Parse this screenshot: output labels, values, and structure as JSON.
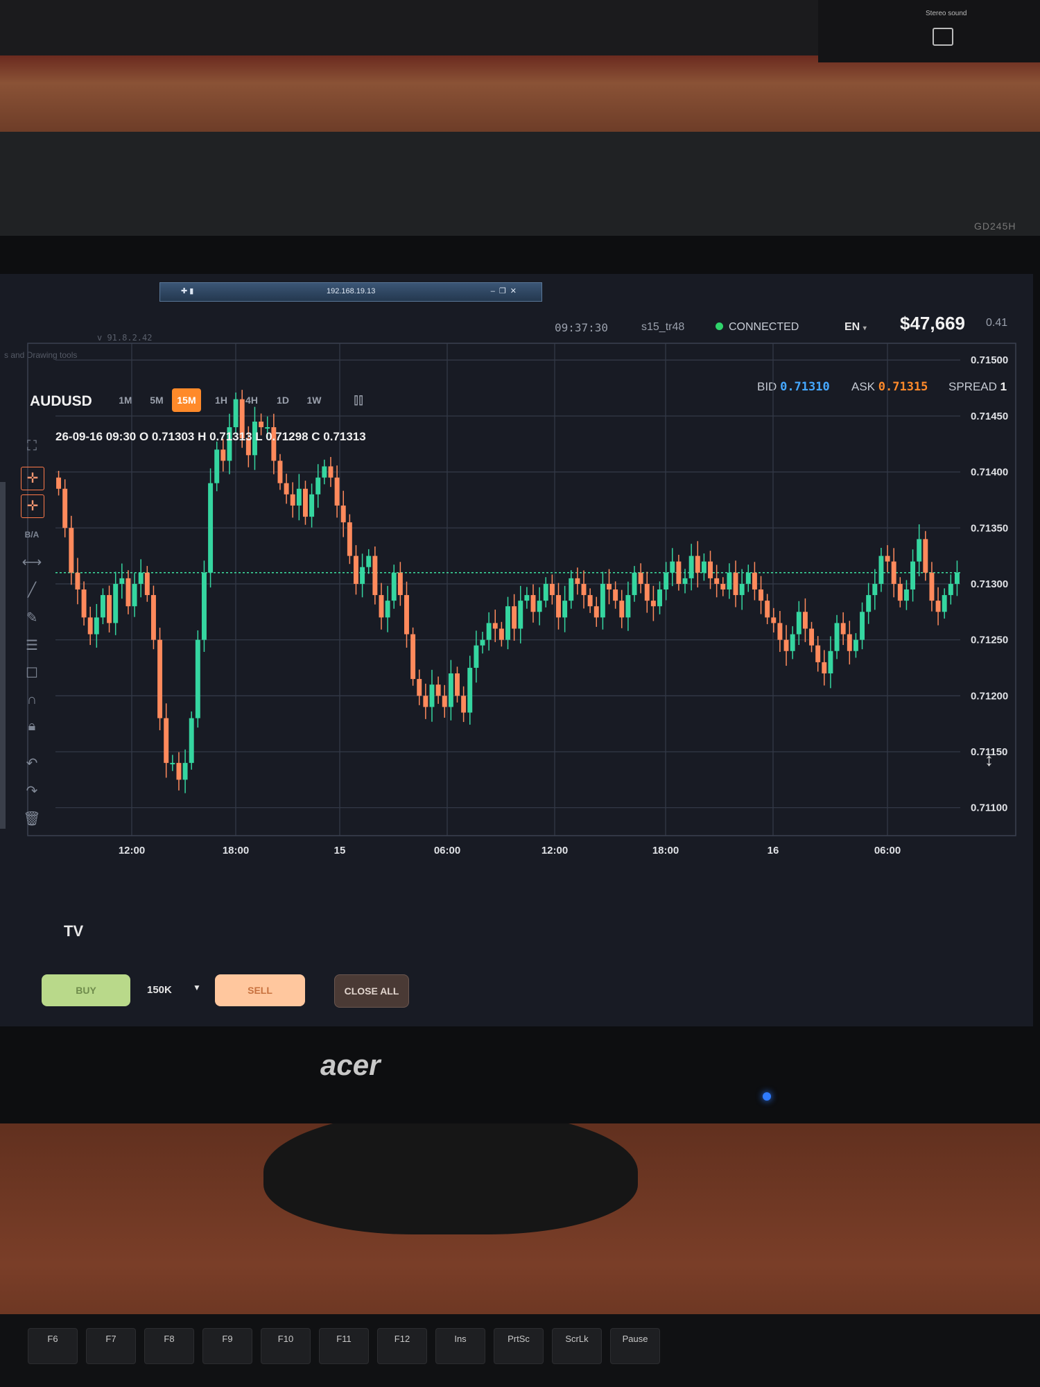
{
  "environment": {
    "speaker_label": "Stereo sound",
    "monitor_model": "GD245H",
    "monitor_brand": "acer",
    "keys": [
      "F6",
      "F7",
      "F8",
      "F9",
      "F10",
      "F11",
      "F12",
      "Ins",
      "PrtSc",
      "ScrLk",
      "Pause"
    ]
  },
  "remote": {
    "ip": "192.168.19.13"
  },
  "app": {
    "version": "v 91.8.2.42",
    "title_fragment": "s and Drawing tools"
  },
  "header": {
    "clock": "09:37:30",
    "user": "s15_tr48",
    "connection": "CONNECTED",
    "language": "EN",
    "balance": "$47,669",
    "balance_sub": "0.41"
  },
  "instrument": {
    "symbol": "AUDUSD",
    "timeframes": [
      "1M",
      "5M",
      "15M",
      "1H",
      "4H",
      "1D",
      "1W"
    ],
    "active_timeframe": "15M",
    "bid_label": "BID",
    "bid": "0.71310",
    "ask_label": "ASK",
    "ask": "0.71315",
    "spread_label": "SPREAD",
    "spread": "1"
  },
  "ohlc_legend": "26-09-16 09:30 O 0.71303 H 0.71313 L 0.71298 C 0.71313",
  "tools": {
    "ba_label": "B/A"
  },
  "order": {
    "buy": "BUY",
    "quantity": "150K",
    "sell": "SELL",
    "close_all": "CLOSE ALL"
  },
  "colors": {
    "up": "#35d6a0",
    "down": "#ff8a5c",
    "accent": "#ff8a2a",
    "bid": "#45a8ff"
  },
  "chart_data": {
    "type": "candlestick",
    "y_ticks": [
      "0.71500",
      "0.71450",
      "0.71400",
      "0.71350",
      "0.71300",
      "0.71250",
      "0.71200",
      "0.71150",
      "0.71100"
    ],
    "ylim": [
      0.71075,
      0.71515
    ],
    "x_ticks": [
      "12:00",
      "18:00",
      "15",
      "06:00",
      "12:00",
      "18:00",
      "16",
      "06:00"
    ],
    "current_price": 0.7131,
    "grid": true,
    "close_series": [
      0.71385,
      0.7135,
      0.7131,
      0.71295,
      0.7127,
      0.71255,
      0.7127,
      0.7129,
      0.71265,
      0.713,
      0.71305,
      0.7128,
      0.713,
      0.7131,
      0.7129,
      0.7125,
      0.7118,
      0.7114,
      0.7114,
      0.71125,
      0.7114,
      0.7118,
      0.7125,
      0.7131,
      0.7139,
      0.7142,
      0.7141,
      0.7144,
      0.71465,
      0.7143,
      0.71415,
      0.71445,
      0.7144,
      0.7144,
      0.7141,
      0.7139,
      0.7138,
      0.7137,
      0.71385,
      0.7136,
      0.7138,
      0.71395,
      0.71405,
      0.71395,
      0.7137,
      0.71355,
      0.71325,
      0.713,
      0.71315,
      0.71325,
      0.7129,
      0.7127,
      0.71285,
      0.7131,
      0.7129,
      0.71255,
      0.71215,
      0.712,
      0.7119,
      0.7121,
      0.712,
      0.7119,
      0.7122,
      0.712,
      0.71185,
      0.71225,
      0.71245,
      0.7125,
      0.71265,
      0.7126,
      0.7125,
      0.7128,
      0.7126,
      0.71285,
      0.7129,
      0.71275,
      0.71285,
      0.713,
      0.7129,
      0.7127,
      0.71285,
      0.71305,
      0.713,
      0.7129,
      0.7128,
      0.7127,
      0.713,
      0.71295,
      0.71285,
      0.7127,
      0.7129,
      0.7131,
      0.713,
      0.71285,
      0.7128,
      0.71295,
      0.7131,
      0.7132,
      0.713,
      0.71305,
      0.71325,
      0.7131,
      0.7132,
      0.71305,
      0.713,
      0.71295,
      0.7131,
      0.7129,
      0.713,
      0.7131,
      0.71295,
      0.71285,
      0.7127,
      0.71265,
      0.7125,
      0.7124,
      0.71255,
      0.71275,
      0.7126,
      0.71245,
      0.7123,
      0.7122,
      0.7124,
      0.71265,
      0.71255,
      0.7124,
      0.7125,
      0.71275,
      0.7129,
      0.713,
      0.71325,
      0.7132,
      0.713,
      0.71285,
      0.71295,
      0.7132,
      0.7134,
      0.7131,
      0.71285,
      0.71275,
      0.7129,
      0.713,
      0.7131
    ]
  }
}
